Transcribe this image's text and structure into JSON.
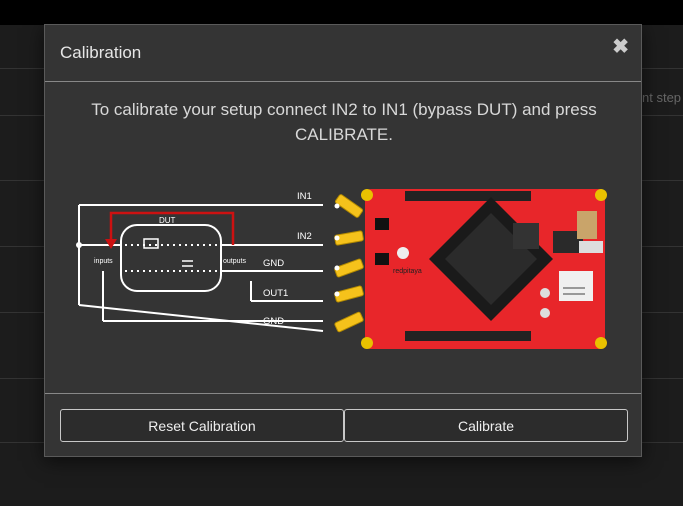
{
  "background": {
    "hint_text": "nt step"
  },
  "dialog": {
    "title": "Calibration",
    "close_symbol": "✖",
    "message": "To calibrate your setup connect IN2 to IN1 (bypass DUT) and press CALIBRATE.",
    "diagram": {
      "dut_label": "DUT",
      "inputs_label": "inputs",
      "outputs_label": "outputs",
      "ports": [
        "IN1",
        "IN2",
        "GND",
        "OUT1",
        "GND"
      ],
      "board_logo": "redpitaya"
    },
    "buttons": {
      "reset": "Reset Calibration",
      "calibrate": "Calibrate"
    }
  },
  "colors": {
    "board": "#e8262a",
    "connector": "#f5c21b",
    "accent_red": "#cc1111"
  }
}
